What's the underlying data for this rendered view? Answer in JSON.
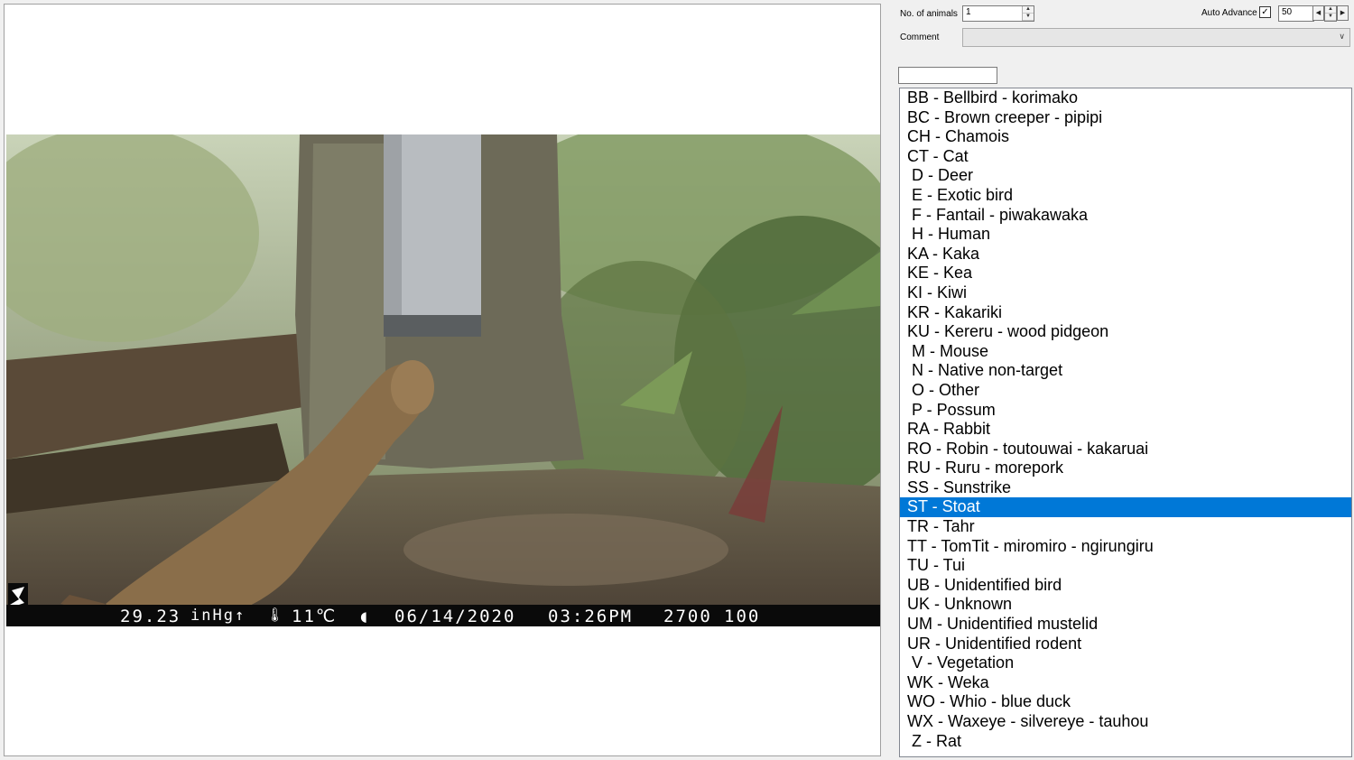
{
  "photo": {
    "info_bar": {
      "pressure": "29.23",
      "pressure_unit": "inHg↑",
      "temp_icon": "ἲ1",
      "temperature": "11℃",
      "moon_icon": "◖",
      "date": "06/14/2020",
      "time": "03:26PM",
      "code1": "2700",
      "code2": "100"
    }
  },
  "controls": {
    "animals_label": "No. of animals",
    "animals_value": "1",
    "auto_advance_label": "Auto Advance",
    "auto_advance_checked": "✓",
    "auto_advance_value": "50",
    "comment_label": "Comment",
    "comment_value": "",
    "filter_value": ""
  },
  "species_list": [
    "BB - Bellbird - korimako",
    "BC - Brown creeper - pipipi",
    "CH - Chamois",
    "CT - Cat",
    " D - Deer",
    " E - Exotic bird",
    " F - Fantail - piwakawaka",
    " H - Human",
    "KA - Kaka",
    "KE - Kea",
    "KI - Kiwi",
    "KR - Kakariki",
    "KU - Kereru - wood pidgeon",
    " M - Mouse",
    " N - Native non-target",
    " O - Other",
    " P - Possum",
    "RA - Rabbit",
    "RO - Robin - toutouwai - kakaruai",
    "RU - Ruru - morepork",
    "SS - Sunstrike",
    "ST - Stoat",
    "TR - Tahr",
    "TT - TomTit - miromiro - ngirungiru",
    "TU - Tui",
    "UB - Unidentified bird",
    "UK - Unknown",
    "UM - Unidentified mustelid",
    "UR - Unidentified rodent",
    " V - Vegetation",
    "WK - Weka",
    "WO - Whio - blue duck",
    "WX - Waxeye - silvereye - tauhou",
    " Z - Rat"
  ],
  "selected_species": "ST - Stoat",
  "colors": {
    "selection": "#0078d7"
  }
}
